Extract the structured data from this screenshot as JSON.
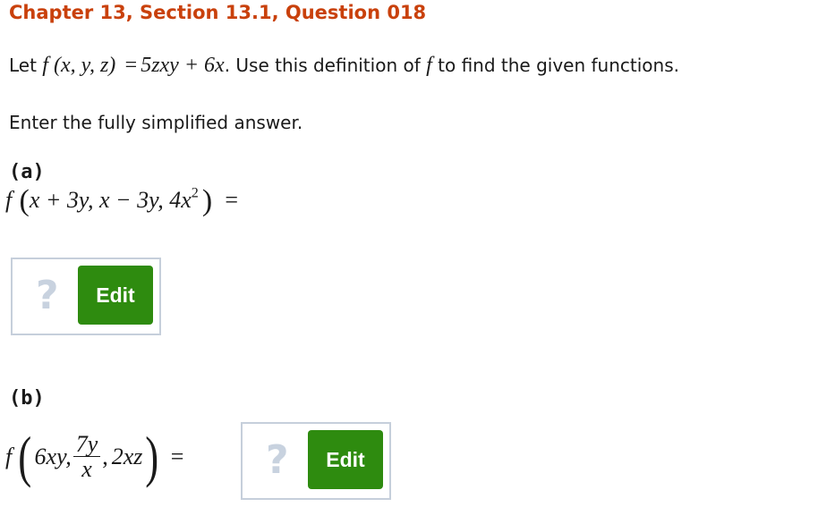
{
  "header": {
    "title": "Chapter 13, Section 13.1, Question 018"
  },
  "intro": {
    "prefix": "Let",
    "definition": {
      "lhs": "f (x, y, z)",
      "eq": "=",
      "rhs": "5zxy + 6x"
    },
    "suffix_before_f": ". Use this definition of",
    "f": "f",
    "suffix_after_f": "to find the given functions."
  },
  "instruction": "Enter the fully simplified answer.",
  "parts": [
    {
      "label": "(a)",
      "expression": {
        "f": "f",
        "args": "x + 3y, x − 3y, 4x",
        "sup": "2",
        "eq": "="
      },
      "answer": {
        "placeholder_icon": "?",
        "edit_label": "Edit"
      }
    },
    {
      "label": "(b)",
      "expression": {
        "f": "f",
        "arg1": "6xy,",
        "frac_num": "7y",
        "frac_den": "x",
        "sep": ",",
        "arg3": "2xz",
        "eq": "="
      },
      "answer": {
        "placeholder_icon": "?",
        "edit_label": "Edit"
      }
    }
  ],
  "colors": {
    "heading": "#c9410c",
    "button": "#2e8b0f",
    "box_border": "#c6cfdb",
    "placeholder": "#c8d2df"
  }
}
